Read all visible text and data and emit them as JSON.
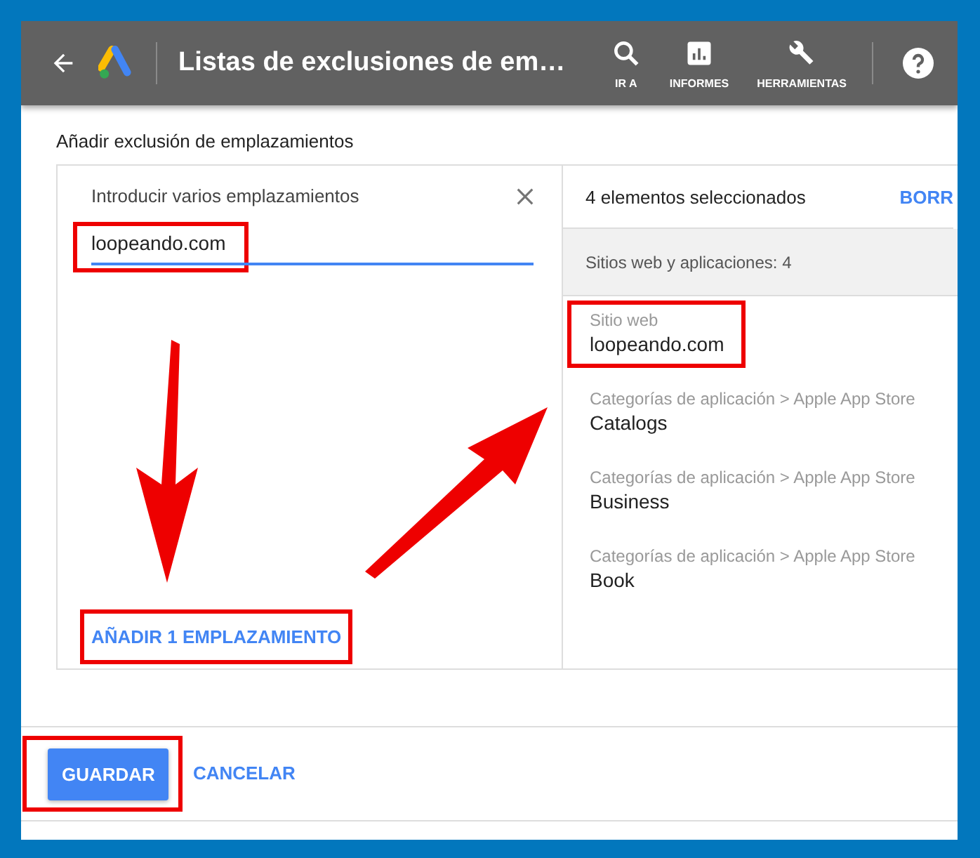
{
  "header": {
    "title": "Listas de exclusiones de em…",
    "nav": [
      {
        "kind": "search",
        "label": "IR A"
      },
      {
        "kind": "reports",
        "label": "INFORMES"
      },
      {
        "kind": "tools",
        "label": "HERRAMIENTAS"
      }
    ]
  },
  "section_title": "Añadir exclusión de emplazamientos",
  "entry": {
    "label": "Introducir varios emplazamientos",
    "value": "loopeando.com",
    "add_button": "AÑADIR 1 EMPLAZAMIENTO"
  },
  "selection": {
    "count_text": "4 elementos seleccionados",
    "clear_link": "BORR",
    "group": "Sitios web y aplicaciones: 4",
    "items": [
      {
        "category": "Sitio web",
        "name": "loopeando.com",
        "highlighted": true
      },
      {
        "category": "Categorías de aplicación > Apple App Store",
        "name": "Catalogs",
        "highlighted": false
      },
      {
        "category": "Categorías de aplicación > Apple App Store",
        "name": "Business",
        "highlighted": false
      },
      {
        "category": "Categorías de aplicación > Apple App Store",
        "name": "Book",
        "highlighted": false
      }
    ]
  },
  "footer": {
    "save": "GUARDAR",
    "cancel": "CANCELAR"
  }
}
